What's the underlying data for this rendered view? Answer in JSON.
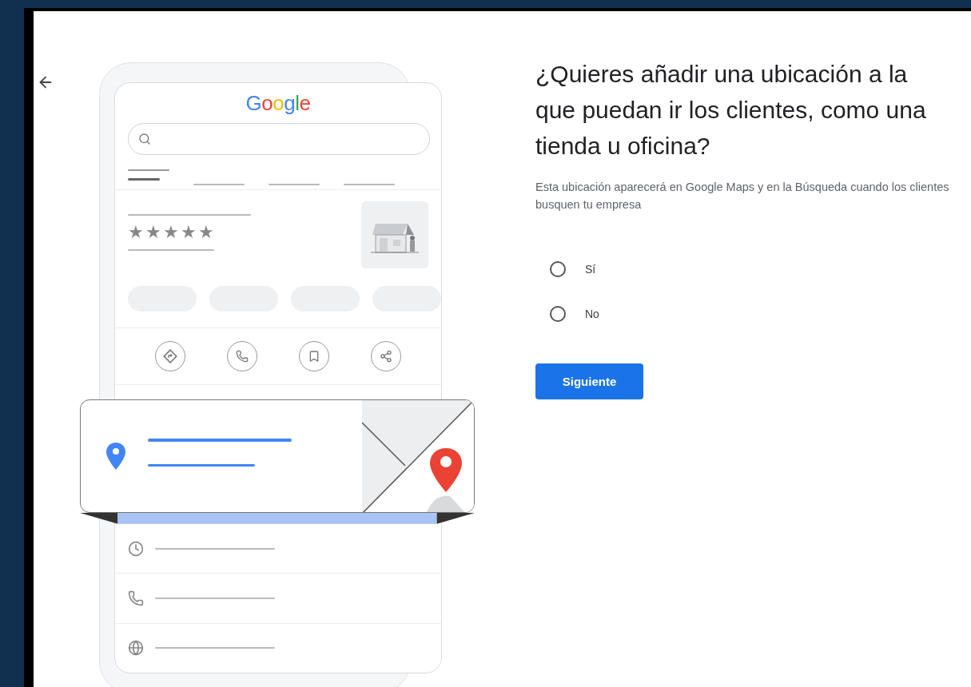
{
  "illustration": {
    "logo": "Google",
    "stars": 5
  },
  "question": {
    "title": "¿Quieres añadir una ubicación a la que puedan ir los clientes, como una tienda u oficina?",
    "description": "Esta ubicación aparecerá en Google Maps y en la Búsqueda cuando los clientes busquen tu empresa"
  },
  "options": [
    {
      "label": "Sí",
      "selected": false
    },
    {
      "label": "No",
      "selected": false
    }
  ],
  "next_button": "Siguiente"
}
